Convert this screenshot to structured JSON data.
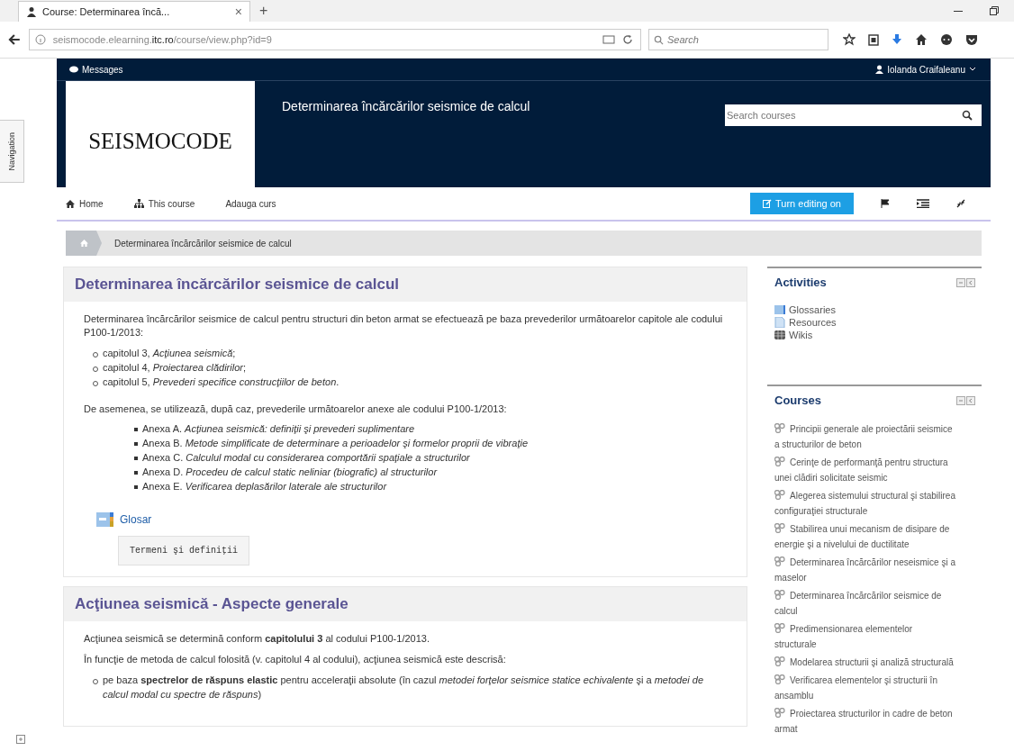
{
  "browser": {
    "tab_title": "Course: Determinarea încă...",
    "tab_close": "×",
    "new_tab": "+",
    "url_prefix": "seismocode.elearning.",
    "url_domain": "itc.ro",
    "url_path": "/course/view.php?id=9",
    "search_placeholder": "Search"
  },
  "side_tab": {
    "label": "Navigation"
  },
  "topbar": {
    "messages": "Messages",
    "user": "Iolanda Craifaleanu"
  },
  "header": {
    "logo": "SEISMOCODE",
    "course_title": "Determinarea încărcărilor seismice de calcul",
    "search_placeholder": "Search courses"
  },
  "navbar": {
    "items": [
      {
        "label": "Home",
        "kind": "home"
      },
      {
        "label": "This course",
        "kind": "course"
      },
      {
        "label": "Adauga curs",
        "kind": "plain"
      }
    ],
    "edit_button": "Turn editing on"
  },
  "breadcrumb": {
    "current": "Determinarea încărcărilor seismice de calcul"
  },
  "sections": [
    {
      "title": "Determinarea încărcărilor seismice de calcul",
      "blocks": [
        {
          "kind": "para",
          "text": "Determinarea încărcărilor seismice de calcul pentru structuri din beton armat se efectuează pe baza prevederilor următoarelor capitole ale codului P100-1/2013:"
        },
        {
          "kind": "circle_list",
          "items": [
            "capitolul 3, *Acţiunea seismică*;",
            "capitolul 4, *Proiectarea clădirilor*;",
            "capitolul 5, *Prevederi specifice construcţiilor de beton*."
          ]
        },
        {
          "kind": "para",
          "text": "De asemenea, se utilizează, după caz, prevederile următoarelor anexe ale codului P100-1/2013:"
        },
        {
          "kind": "square_list",
          "items": [
            "Anexa A. *Acţiunea seismică: definiţii şi prevederi suplimentare*",
            "Anexa B. *Metode simplificate de determinare a perioadelor şi formelor proprii de vibraţie*",
            "Anexa C. *Calculul modal cu considerarea comportării spaţiale a structurilor*",
            "Anexa D. *Procedeu de calcul static neliniar (biografic) al structurilor*",
            "Anexa E. *Verificarea deplasărilor laterale ale structurilor*"
          ]
        },
        {
          "kind": "glossary",
          "link": "Glosar",
          "description": "Termeni şi definiţii"
        }
      ]
    },
    {
      "title": "Acţiunea seismică - Aspecte generale",
      "blocks": [
        {
          "kind": "para",
          "text": "Acţiunea seismică se determină conform **capitolului 3** al codului P100-1/2013."
        },
        {
          "kind": "para",
          "text": "În funcţie de metoda de calcul folosită (v. capitolul 4 al codului), acţiunea seismică este descrisă:"
        },
        {
          "kind": "circle_list",
          "items": [
            "pe baza **spectrelor de răspuns elastic** pentru acceleraţii absolute (în cazul *metodei forţelor seismice statice echivalente* şi a *metodei de calcul modal cu spectre de răspuns*)"
          ]
        }
      ]
    }
  ],
  "blocks": [
    {
      "title": "Activities",
      "kind": "activities",
      "items": [
        {
          "label": "Glossaries",
          "kind": "glossary"
        },
        {
          "label": "Resources",
          "kind": "resource"
        },
        {
          "label": "Wikis",
          "kind": "wiki"
        }
      ]
    },
    {
      "title": "Courses",
      "kind": "courses",
      "items": [
        {
          "label": "Principii generale ale proiectării seismice a structurilor de beton",
          "kind": "course"
        },
        {
          "label": "Cerinţe de performanţă pentru structura unei clădiri solicitate seismic",
          "kind": "course"
        },
        {
          "label": "Alegerea sistemului structural şi stabilirea configuraţiei structurale",
          "kind": "course"
        },
        {
          "label": "Stabilirea unui mecanism de disipare de energie şi a nivelului de ductilitate",
          "kind": "course"
        },
        {
          "label": "Determinarea încărcărilor neseismice şi a maselor",
          "kind": "course"
        },
        {
          "label": "Determinarea încărcărilor seismice de calcul",
          "kind": "course"
        },
        {
          "label": "Predimensionarea elementelor structurale",
          "kind": "course"
        },
        {
          "label": "Modelarea structurii şi analiză structurală",
          "kind": "course"
        },
        {
          "label": "Verificarea elementelor şi structurii în ansamblu",
          "kind": "course"
        },
        {
          "label": "Proiectarea structurilor in cadre de beton armat",
          "kind": "course"
        }
      ]
    }
  ]
}
